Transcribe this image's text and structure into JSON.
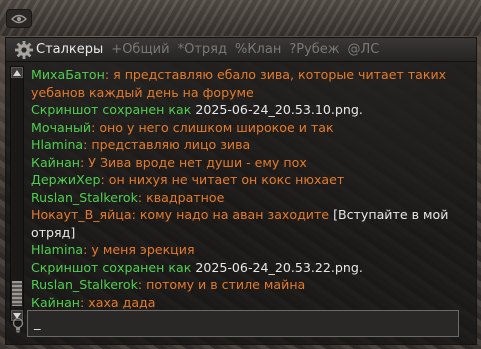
{
  "tabs": [
    {
      "label": "Сталкеры",
      "active": true
    },
    {
      "label": "+Общий",
      "active": false
    },
    {
      "label": "*Отряд",
      "active": false
    },
    {
      "label": "%Клан",
      "active": false
    },
    {
      "label": "?Рубеж",
      "active": false
    },
    {
      "label": "@ЛС",
      "active": false
    }
  ],
  "messages": [
    {
      "nick": "МихаБатон",
      "text": "я представляю ебало зива, которые читает таких уебанов каждый день на форуме"
    },
    {
      "system": "Скриншот сохранен как ",
      "file": "2025-06-24_20.53.10.png."
    },
    {
      "nick": "Мочаный",
      "text": "оно у него слишком широкое и так"
    },
    {
      "nick": "Hlamina",
      "text": "представляю лицо зива"
    },
    {
      "nick": "Кайнан",
      "text": "У Зива вроде нет души - ему пох"
    },
    {
      "nick": "ДержиХер",
      "text": "он нихуя не читает он кокс нюхает"
    },
    {
      "nick": "Ruslan_Stalkerok",
      "text": "квадратное"
    },
    {
      "nick": "Нокаут_В_яйца",
      "text": "кому надо на аван заходите ",
      "extra": "[Вступайте в мой отряд]"
    },
    {
      "nick": "Hlamina",
      "text": "у меня эрекция"
    },
    {
      "system": "Скриншот сохранен как ",
      "file": "2025-06-24_20.53.22.png."
    },
    {
      "nick": "Ruslan_Stalkerok",
      "text": "потому и в стиле майна"
    },
    {
      "nick": "Кайнан",
      "text": "хаха дада"
    }
  ],
  "input": {
    "value": "_"
  },
  "icons": {
    "visibility": "eye-icon",
    "settings": "gear-icon",
    "hint": "lightbulb-icon"
  },
  "colors": {
    "nick": "#4fcf4f",
    "message": "#e57b2a",
    "system": "#4fcf4f",
    "file": "#e8e8e8"
  }
}
